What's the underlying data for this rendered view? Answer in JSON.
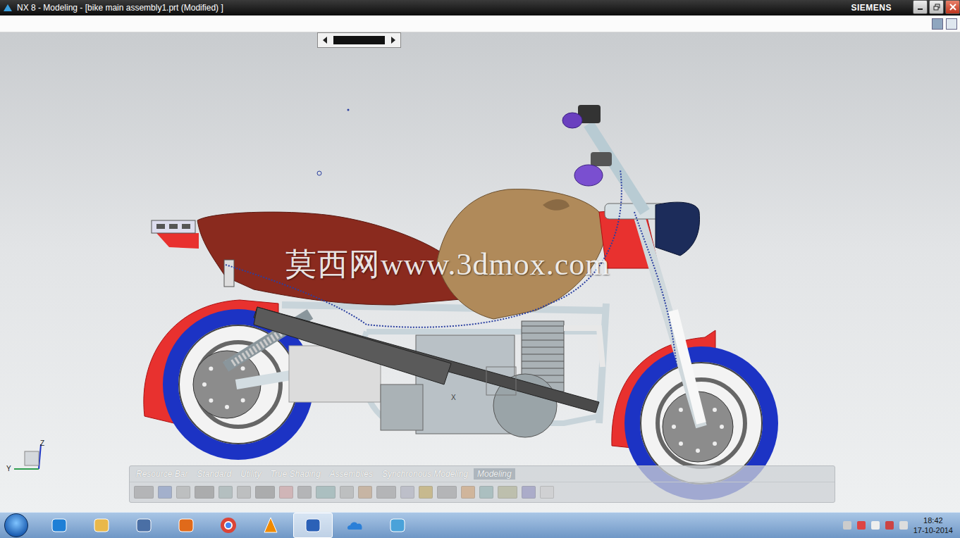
{
  "window": {
    "title": "NX 8 - Modeling - [bike main assembly1.prt (Modified) ]",
    "brand": "SIEMENS"
  },
  "graphics": {
    "watermark": "莫西网www.3dmox.com",
    "triad_labels": [
      "Z",
      "Y"
    ],
    "workplane_label": "X"
  },
  "toolbar": {
    "tabs": [
      {
        "label": "Resource Bar",
        "selected": false
      },
      {
        "label": "Standard",
        "selected": false
      },
      {
        "label": "Utility",
        "selected": false
      },
      {
        "label": "True Shading",
        "selected": false
      },
      {
        "label": "Assemblies",
        "selected": false
      },
      {
        "label": "Synchronous Modeling",
        "selected": false
      },
      {
        "label": "Modeling",
        "selected": true
      }
    ]
  },
  "taskbar": {
    "apps": [
      {
        "selected": false
      },
      {
        "selected": false
      },
      {
        "selected": false
      },
      {
        "selected": false
      },
      {
        "selected": false
      },
      {
        "selected": false
      },
      {
        "selected": true
      },
      {
        "selected": false
      },
      {
        "selected": false
      }
    ],
    "time": "18:42",
    "date": "17-10-2014"
  }
}
